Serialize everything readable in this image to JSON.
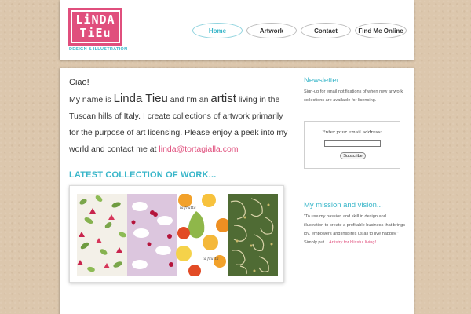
{
  "logo": {
    "line1": "LiNDA",
    "line2": "TiEu",
    "tagline": "DESIGN & ILLUSTRATION"
  },
  "nav": {
    "items": [
      {
        "label": "Home",
        "active": true
      },
      {
        "label": "Artwork",
        "active": false
      },
      {
        "label": "Contact",
        "active": false
      },
      {
        "label": "Find Me Online",
        "active": false
      }
    ]
  },
  "intro": {
    "greeting": "Ciao!",
    "p1": "My name is ",
    "name": "Linda Tieu",
    "p2": " and I'm an ",
    "artist": "artist",
    "p3": " living in the Tuscan hills of Italy. I create collections of artwork primarily for the purpose of art licensing. Please enjoy a peek into my world and contact me at ",
    "email": "linda@tortagialla.com"
  },
  "collection": {
    "title": "LATEST COLLECTION OF WORK...",
    "panel_text": "la frutta"
  },
  "newsletter": {
    "title": "Newsletter",
    "text": "Sign-up for email notifications of when new artwork collections are available for licensing.",
    "label": "Enter your email address:",
    "input_value": "",
    "button": "Subscribe"
  },
  "mission": {
    "title": "My mission and vision...",
    "text": "\"To use my passion and skill in design and illustration to create a profitable business that brings joy, empowers and inspires us all to live happily.\" Simply put...",
    "highlight": "Artistry for blissful living!"
  },
  "colors": {
    "accent": "#39b6c9",
    "brand": "#e04f7d",
    "background": "#dcc7ad"
  }
}
